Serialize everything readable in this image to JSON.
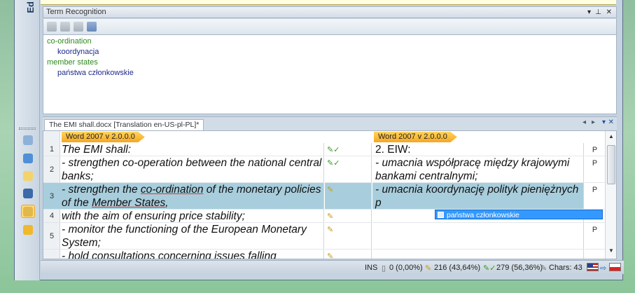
{
  "window": {
    "edge_label": "Ed"
  },
  "term_recognition": {
    "title": "Term Recognition",
    "controls": [
      "▾",
      "⊥",
      "✕"
    ],
    "terms": [
      {
        "source": "co-ordination",
        "target": "koordynacja"
      },
      {
        "source": "member states",
        "target": "państwa członkowskie"
      }
    ]
  },
  "document": {
    "tab_title": "The EMI shall.docx [Translation en-US-pl-PL]*",
    "tab_controls": [
      "◂",
      "▸",
      "▾",
      "✕"
    ],
    "source_label": "Word 2007 v 2.0.0.0",
    "target_label": "Word 2007 v 2.0.0.0",
    "rows": [
      {
        "num": "1",
        "source": "The EMI shall:",
        "target": "2. EIW:",
        "status": "P"
      },
      {
        "num": "2",
        "source": "- strengthen co-operation between the national central banks;",
        "target": "- umacnia współpracę między krajowymi bankami centralnymi;",
        "status": "P"
      },
      {
        "num": "3",
        "source_parts": [
          "- strengthen the ",
          "co-ordination",
          " of the monetary policies of the ",
          "Member States",
          ","
        ],
        "target": "- umacnia koordynację polityk pieniężnych p",
        "status": "P"
      },
      {
        "num": "4",
        "source": "with the aim of ensuring price stability;",
        "target": "",
        "status": ""
      },
      {
        "num": "5",
        "source": "- monitor the functioning of the European Monetary System;",
        "target": "",
        "status": "P"
      },
      {
        "num": "",
        "source": "- hold consultations concerning issues falling",
        "target": "",
        "status": ""
      }
    ],
    "autosuggest": "państwa członkowskie"
  },
  "status_bar": {
    "mode": "INS",
    "unconfirmed": "0 (0,00%)",
    "draft": "216 (43,64%)",
    "translated": "279 (56,36%)",
    "chars": "Chars: 43"
  },
  "colors": {
    "term_source": "#2e8b1e",
    "term_target": "#1f2a8c",
    "selected_row": "#a8cedd",
    "autosuggest": "#3399ff"
  }
}
